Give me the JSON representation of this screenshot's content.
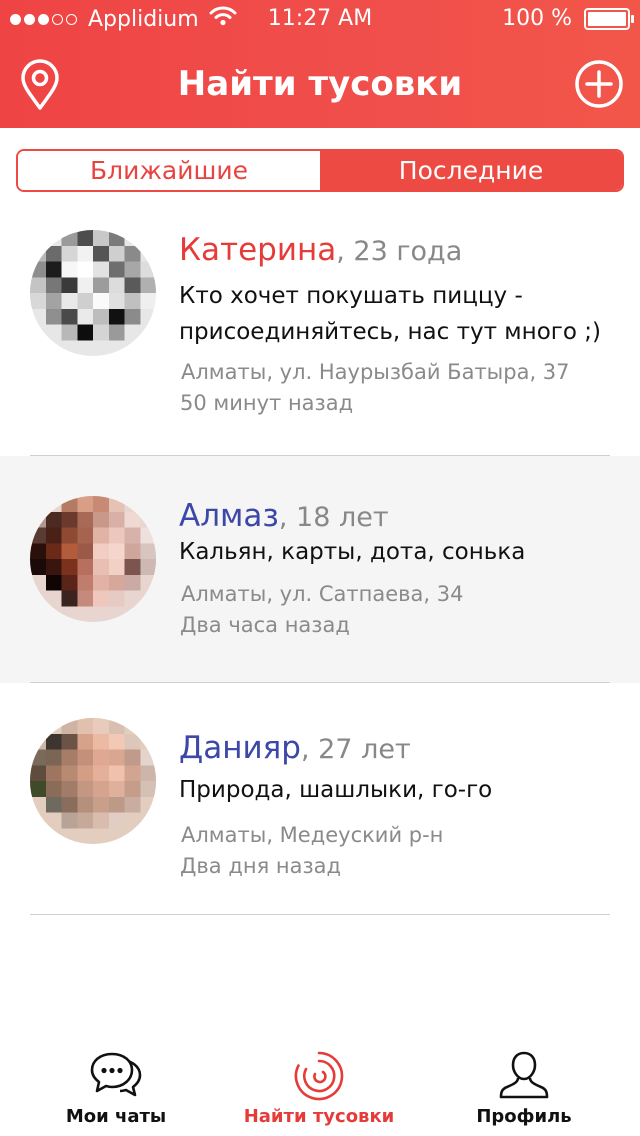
{
  "status_bar": {
    "carrier": "Applidium",
    "time": "11:27 AM",
    "battery": "100 %",
    "signal_dots_filled": 3,
    "signal_dots_total": 5
  },
  "nav": {
    "title": "Найти тусовки",
    "left_icon": "location-pin-icon",
    "right_icon": "plus-circle-icon"
  },
  "segments": {
    "nearest": "Ближайшие",
    "latest": "Последние"
  },
  "feed": [
    {
      "name": "Катерина",
      "age": ", 23 года",
      "message_line1": "Кто хочет покушать пиццу -",
      "message_line2": "присоединяйтесь, нас тут много ;)",
      "address": "Алматы, ул. Наурызбай Батыра, 37",
      "time_ago": "50 минут назад",
      "name_color": "#e53c3a"
    },
    {
      "name": "Алмаз",
      "age": ", 18 лет",
      "message_line1": "Кальян, карты, дота, сонька",
      "address": "Алматы, ул. Сатпаева, 34",
      "time_ago": "Два часа назад",
      "name_color": "#3c47a8"
    },
    {
      "name": "Данияр",
      "age": ", 27 лет",
      "message_line1": "Природа, шашлыки, го-го",
      "address": "Алматы, Медеуский р-н",
      "time_ago": "Два дня назад",
      "name_color": "#3c47a8"
    }
  ],
  "tabbar": {
    "chats": "Мои чаты",
    "find": "Найти тусовки",
    "profile": "Профиль",
    "active_color": "#e53c3a"
  }
}
